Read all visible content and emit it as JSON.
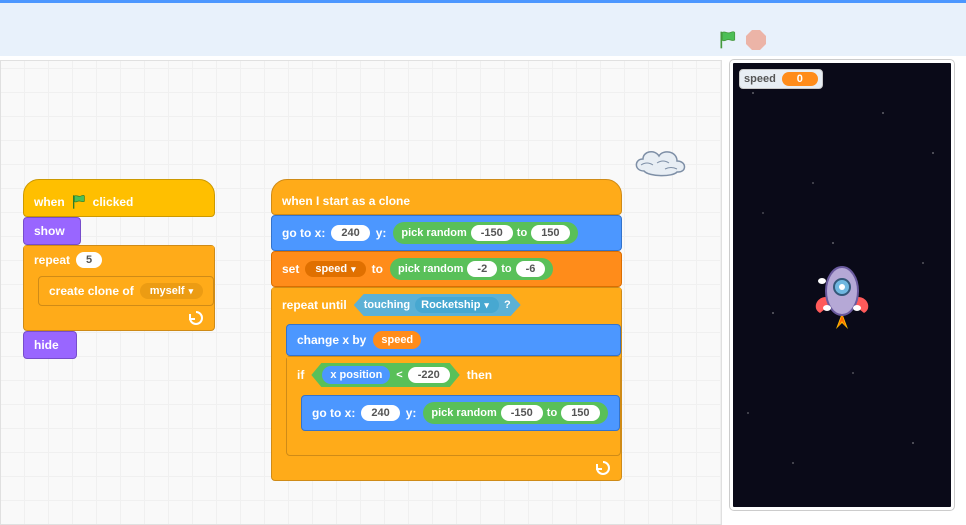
{
  "stage": {
    "var_name": "speed",
    "var_value": "0"
  },
  "stack1": {
    "hat": {
      "pre": "when",
      "post": "clicked"
    },
    "show": "show",
    "repeat": {
      "label": "repeat",
      "times": "5"
    },
    "create_clone": {
      "label": "create clone of",
      "target": "myself"
    },
    "hide": "hide"
  },
  "stack2": {
    "hat": "when I start as a clone",
    "goto1": {
      "label_go": "go to x:",
      "x": "240",
      "label_y": "y:",
      "rand": "pick random",
      "a": "-150",
      "to": "to",
      "b": "150"
    },
    "set": {
      "label": "set",
      "var": "speed",
      "to": "to",
      "rand": "pick random",
      "a": "-2",
      "to2": "to",
      "b": "-6"
    },
    "repeat_until": {
      "label": "repeat until",
      "touching": "touching",
      "target": "Rocketship",
      "q": "?"
    },
    "change_x": {
      "label": "change x by",
      "var": "speed"
    },
    "if": {
      "label": "if",
      "xpos": "x position",
      "lt": "<",
      "val": "-220",
      "then": "then"
    },
    "goto2": {
      "label_go": "go to x:",
      "x": "240",
      "label_y": "y:",
      "rand": "pick random",
      "a": "-150",
      "to": "to",
      "b": "150"
    }
  }
}
